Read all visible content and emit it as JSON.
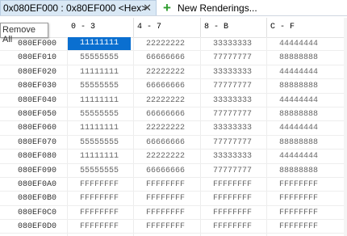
{
  "tabs": {
    "active_label": "0x080EF000 : 0x80EF000 <Hex>",
    "close_glyph": "✕",
    "new_label": "New Renderings...",
    "plus_glyph": "+",
    "icon": "plus-icon"
  },
  "tooltip": {
    "text": "Remove All"
  },
  "columns": [
    "0 - 3",
    "4 - 7",
    "8 - B",
    "C - F"
  ],
  "rows": [
    {
      "addr": "080EF000",
      "cells": [
        "11111111",
        "22222222",
        "33333333",
        "44444444"
      ]
    },
    {
      "addr": "080EF010",
      "cells": [
        "55555555",
        "66666666",
        "77777777",
        "88888888"
      ]
    },
    {
      "addr": "080EF020",
      "cells": [
        "11111111",
        "22222222",
        "33333333",
        "44444444"
      ]
    },
    {
      "addr": "080EF030",
      "cells": [
        "55555555",
        "66666666",
        "77777777",
        "88888888"
      ]
    },
    {
      "addr": "080EF040",
      "cells": [
        "11111111",
        "22222222",
        "33333333",
        "44444444"
      ]
    },
    {
      "addr": "080EF050",
      "cells": [
        "55555555",
        "66666666",
        "77777777",
        "88888888"
      ]
    },
    {
      "addr": "080EF060",
      "cells": [
        "11111111",
        "22222222",
        "33333333",
        "44444444"
      ]
    },
    {
      "addr": "080EF070",
      "cells": [
        "55555555",
        "66666666",
        "77777777",
        "88888888"
      ]
    },
    {
      "addr": "080EF080",
      "cells": [
        "11111111",
        "22222222",
        "33333333",
        "44444444"
      ]
    },
    {
      "addr": "080EF090",
      "cells": [
        "55555555",
        "66666666",
        "77777777",
        "88888888"
      ]
    },
    {
      "addr": "080EF0A0",
      "cells": [
        "FFFFFFFF",
        "FFFFFFFF",
        "FFFFFFFF",
        "FFFFFFFF"
      ]
    },
    {
      "addr": "080EF0B0",
      "cells": [
        "FFFFFFFF",
        "FFFFFFFF",
        "FFFFFFFF",
        "FFFFFFFF"
      ]
    },
    {
      "addr": "080EF0C0",
      "cells": [
        "FFFFFFFF",
        "FFFFFFFF",
        "FFFFFFFF",
        "FFFFFFFF"
      ]
    },
    {
      "addr": "080EF0D0",
      "cells": [
        "FFFFFFFF",
        "FFFFFFFF",
        "FFFFFFFF",
        "FFFFFFFF"
      ]
    }
  ],
  "selection": {
    "row": 0,
    "col": 0
  },
  "colors": {
    "selection": "#0a6fd0",
    "tab_active": "#d9e8f5",
    "plus": "#2f9d2f"
  }
}
